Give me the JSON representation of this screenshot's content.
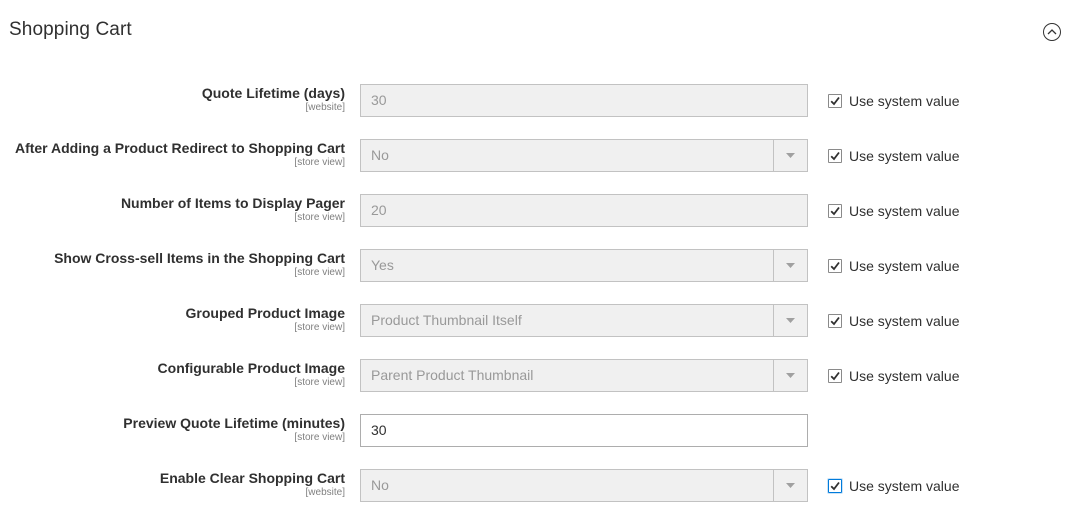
{
  "section": {
    "title": "Shopping Cart",
    "toggle_icon": "chevron-up-circle-icon"
  },
  "colors": {
    "text": "#303030",
    "scope": "#808080",
    "disabled_bg": "#f0f0f0",
    "focus_accent": "#007bdb"
  },
  "rows": [
    {
      "label": "Quote Lifetime (days)",
      "scope": "[website]",
      "type": "text",
      "value": "30",
      "disabled": true,
      "use_system": true,
      "system_label": "Use system value"
    },
    {
      "label": "After Adding a Product Redirect to Shopping Cart",
      "scope": "[store view]",
      "type": "select",
      "value": "No",
      "disabled": true,
      "use_system": true,
      "system_label": "Use system value"
    },
    {
      "label": "Number of Items to Display Pager",
      "scope": "[store view]",
      "type": "text",
      "value": "20",
      "disabled": true,
      "use_system": true,
      "system_label": "Use system value"
    },
    {
      "label": "Show Cross-sell Items in the Shopping Cart",
      "scope": "[store view]",
      "type": "select",
      "value": "Yes",
      "disabled": true,
      "use_system": true,
      "system_label": "Use system value"
    },
    {
      "label": "Grouped Product Image",
      "scope": "[store view]",
      "type": "select",
      "value": "Product Thumbnail Itself",
      "disabled": true,
      "use_system": true,
      "system_label": "Use system value"
    },
    {
      "label": "Configurable Product Image",
      "scope": "[store view]",
      "type": "select",
      "value": "Parent Product Thumbnail",
      "disabled": true,
      "use_system": true,
      "system_label": "Use system value"
    },
    {
      "label": "Preview Quote Lifetime (minutes)",
      "scope": "[store view]",
      "type": "text",
      "value": "30",
      "disabled": false,
      "use_system": false,
      "system_label": ""
    },
    {
      "label": "Enable Clear Shopping Cart",
      "scope": "[website]",
      "type": "select",
      "value": "No",
      "disabled": true,
      "use_system": true,
      "system_label": "Use system value",
      "focused": true
    }
  ]
}
